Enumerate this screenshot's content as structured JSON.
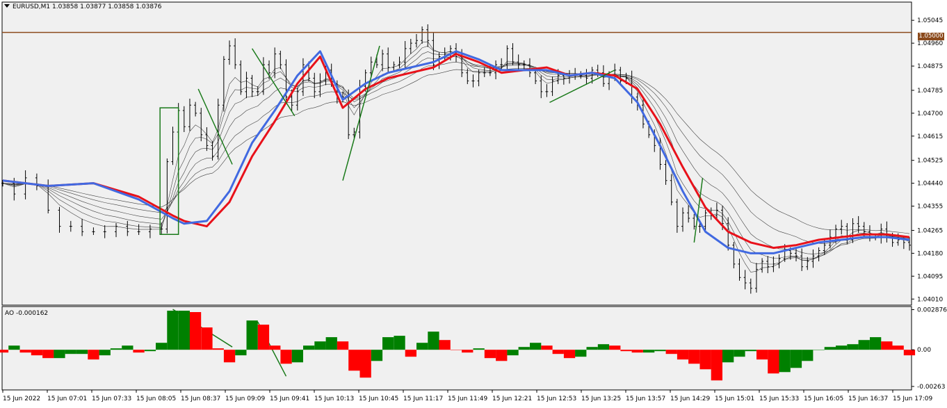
{
  "window": {
    "symbol": "EURUSD,M1",
    "ohlc": [
      "1.03858",
      "1.03877",
      "1.03858",
      "1.03876"
    ]
  },
  "price_line": {
    "label": "1.05000",
    "value": 1.05,
    "color": "#8b4a1c"
  },
  "indicator": {
    "name": "AO",
    "value": "-0.000162"
  },
  "colors": {
    "background": "#f0f0f0",
    "candles": "#000000",
    "ema_fast": "#4169e1",
    "ema_slow": "#e8111a",
    "ribbon": "#404040",
    "annotations": "#1a7a1a",
    "ao_up": "#008000",
    "ao_down": "#ff0000"
  },
  "chart_data": [
    {
      "type": "line",
      "title": "EURUSD,M1",
      "y_ticks": [
        "1.05045",
        "1.04960",
        "1.04875",
        "1.04785",
        "1.04700",
        "1.04615",
        "1.04525",
        "1.04440",
        "1.04355",
        "1.04265",
        "1.04180",
        "1.04095",
        "1.04010"
      ],
      "ylim": [
        1.0399,
        1.0511
      ],
      "x_tick_labels": [
        "15 Jun 2022",
        "15 Jun 07:01",
        "15 Jun 07:33",
        "15 Jun 08:05",
        "15 Jun 08:37",
        "15 Jun 09:09",
        "15 Jun 09:41",
        "15 Jun 10:13",
        "15 Jun 10:45",
        "15 Jun 11:17",
        "15 Jun 11:49",
        "15 Jun 12:21",
        "15 Jun 12:53",
        "15 Jun 13:25",
        "15 Jun 13:57",
        "15 Jun 14:29",
        "15 Jun 15:01",
        "15 Jun 15:33",
        "15 Jun 16:05",
        "15 Jun 16:37",
        "15 Jun 17:09"
      ],
      "series": [
        {
          "name": "",
          "color": "#e8111a",
          "x": [
            0,
            16,
            32,
            48,
            60,
            64,
            72,
            80,
            88,
            96,
            104,
            112,
            120,
            128,
            136,
            144,
            152,
            160,
            168,
            176,
            184,
            192,
            200,
            208,
            216,
            224,
            232,
            240,
            248,
            256,
            264,
            272,
            280,
            288,
            296,
            304,
            312,
            320
          ],
          "values": [
            1.0445,
            1.0443,
            1.0444,
            1.0439,
            1.0432,
            1.043,
            1.0428,
            1.0437,
            1.0454,
            1.0467,
            1.0481,
            1.0491,
            1.0472,
            1.0479,
            1.0483,
            1.0485,
            1.0487,
            1.0492,
            1.0489,
            1.0485,
            1.0486,
            1.0487,
            1.0484,
            1.0485,
            1.0484,
            1.0479,
            1.0466,
            1.045,
            1.0435,
            1.0426,
            1.0422,
            1.042,
            1.0421,
            1.0423,
            1.0424,
            1.0425,
            1.0425,
            1.0424
          ]
        },
        {
          "name": "",
          "color": "#4169e1",
          "x": [
            0,
            16,
            32,
            48,
            60,
            64,
            72,
            80,
            88,
            96,
            104,
            112,
            120,
            128,
            136,
            144,
            152,
            160,
            168,
            176,
            184,
            192,
            200,
            208,
            216,
            224,
            232,
            240,
            248,
            256,
            264,
            272,
            280,
            288,
            296,
            304,
            312,
            320
          ],
          "values": [
            1.0445,
            1.0443,
            1.0444,
            1.0438,
            1.0431,
            1.0429,
            1.043,
            1.0441,
            1.0459,
            1.0471,
            1.0484,
            1.0493,
            1.0475,
            1.0481,
            1.0485,
            1.0487,
            1.0489,
            1.0493,
            1.049,
            1.0486,
            1.0486,
            1.0486,
            1.0484,
            1.0485,
            1.0483,
            1.0474,
            1.0458,
            1.0441,
            1.0426,
            1.042,
            1.0418,
            1.0418,
            1.042,
            1.0422,
            1.0423,
            1.0424,
            1.0424,
            1.0423
          ]
        }
      ],
      "candles": {
        "x": [
          0,
          4,
          8,
          12,
          16,
          20,
          24,
          28,
          32,
          36,
          40,
          44,
          48,
          52,
          56,
          58,
          60,
          62,
          64,
          66,
          68,
          70,
          72,
          74,
          76,
          78,
          80,
          82,
          84,
          86,
          88,
          90,
          92,
          94,
          96,
          98,
          100,
          102,
          104,
          106,
          108,
          110,
          112,
          114,
          116,
          118,
          120,
          122,
          124,
          126,
          128,
          130,
          132,
          134,
          136,
          138,
          140,
          142,
          144,
          146,
          148,
          150,
          152,
          154,
          156,
          158,
          160,
          162,
          164,
          166,
          168,
          170,
          172,
          174,
          176,
          178,
          180,
          182,
          184,
          186,
          188,
          190,
          192,
          194,
          196,
          198,
          200,
          202,
          204,
          206,
          208,
          210,
          212,
          214,
          216,
          218,
          220,
          222,
          224,
          226,
          228,
          230,
          232,
          234,
          236,
          238,
          240,
          242,
          244,
          246,
          248,
          250,
          252,
          254,
          256,
          258,
          260,
          262,
          264,
          266,
          268,
          270,
          272,
          274,
          276,
          278,
          280,
          282,
          284,
          286,
          288,
          290,
          292,
          294,
          296,
          298,
          300,
          302,
          304,
          306,
          308,
          310,
          312,
          314,
          316,
          318,
          320
        ],
        "values": [
          1.0444,
          1.044,
          1.0446,
          1.0443,
          1.0434,
          1.0428,
          1.0428,
          1.0426,
          1.0426,
          1.0426,
          1.0428,
          1.0426,
          1.0426,
          1.0427,
          1.0427,
          1.0452,
          1.0463,
          1.0471,
          1.0465,
          1.0473,
          1.047,
          1.0462,
          1.0458,
          1.0454,
          1.0473,
          1.049,
          1.0495,
          1.0488,
          1.0478,
          1.0483,
          1.0478,
          1.0478,
          1.0488,
          1.0485,
          1.0492,
          1.0488,
          1.0476,
          1.0473,
          1.0478,
          1.0488,
          1.0483,
          1.0478,
          1.0482,
          1.0486,
          1.0481,
          1.0476,
          1.0476,
          1.0462,
          1.0463,
          1.048,
          1.0485,
          1.0489,
          1.0488,
          1.0492,
          1.0487,
          1.0488,
          1.0489,
          1.0494,
          1.0496,
          1.0497,
          1.0501,
          1.0497,
          1.0488,
          1.0491,
          1.0492,
          1.0494,
          1.0491,
          1.0485,
          1.0482,
          1.0482,
          1.0485,
          1.0485,
          1.0485,
          1.0488,
          1.0488,
          1.0494,
          1.0489,
          1.0488,
          1.0488,
          1.0485,
          1.0482,
          1.0478,
          1.0478,
          1.0482,
          1.0484,
          1.0483,
          1.0484,
          1.0484,
          1.0484,
          1.0483,
          1.0486,
          1.0485,
          1.0481,
          1.0484,
          1.0486,
          1.0482,
          1.0483,
          1.0476,
          1.0473,
          1.0466,
          1.0462,
          1.0458,
          1.0451,
          1.0445,
          1.0437,
          1.0428,
          1.0433,
          1.0431,
          1.0428,
          1.0428,
          1.0433,
          1.0432,
          1.0434,
          1.0429,
          1.0421,
          1.0414,
          1.0409,
          1.0407,
          1.0405,
          1.0412,
          1.0415,
          1.0413,
          1.0414,
          1.0416,
          1.0419,
          1.0418,
          1.0417,
          1.0413,
          1.0415,
          1.0417,
          1.0419,
          1.0421,
          1.0424,
          1.0427,
          1.0428,
          1.0423,
          1.0429,
          1.0428,
          1.0426,
          1.0424,
          1.0424,
          1.0427,
          1.0424,
          1.0422,
          1.0423,
          1.0422,
          1.0421
        ]
      }
    },
    {
      "type": "bar",
      "title": "AO -0.000162",
      "y_ticks": [
        "0.002876",
        "0.00",
        "-0.00263"
      ],
      "ylim": [
        -0.00283,
        0.00305
      ],
      "x": [
        0,
        4,
        8,
        12,
        16,
        20,
        24,
        28,
        32,
        36,
        40,
        44,
        48,
        52,
        56,
        60,
        64,
        68,
        72,
        76,
        80,
        84,
        88,
        92,
        96,
        100,
        104,
        108,
        112,
        116,
        120,
        124,
        128,
        132,
        136,
        140,
        144,
        148,
        152,
        156,
        160,
        164,
        168,
        172,
        176,
        180,
        184,
        188,
        192,
        196,
        200,
        204,
        208,
        212,
        216,
        220,
        224,
        228,
        232,
        236,
        240,
        244,
        248,
        252,
        256,
        260,
        264,
        268,
        272,
        276,
        280,
        284,
        288,
        292,
        296,
        300,
        304,
        308,
        312,
        316,
        320
      ],
      "values": [
        -0.0002,
        0.0003,
        -0.0002,
        -0.0004,
        -0.0006,
        -0.0006,
        -0.0003,
        -0.0003,
        -0.0007,
        -0.0004,
        0.0001,
        0.0003,
        -0.0002,
        -0.0001,
        0.0005,
        0.0028,
        0.0028,
        0.0027,
        0.0016,
        0.0001,
        -0.0009,
        -0.0004,
        0.0021,
        0.0018,
        0.0003,
        -0.001,
        -0.0009,
        0.0003,
        0.0006,
        0.0009,
        0.0006,
        -0.0015,
        -0.002,
        -0.0008,
        0.0009,
        0.001,
        -0.0005,
        0.0005,
        0.0013,
        0.0007,
        0.0,
        -0.0002,
        0.0001,
        -0.0006,
        -0.0008,
        -0.0004,
        0.0002,
        0.0005,
        0.0003,
        -0.0003,
        -0.0006,
        -0.0005,
        0.0002,
        0.0004,
        0.0003,
        -0.0001,
        -0.0002,
        -0.0002,
        -0.0001,
        -0.0003,
        -0.0007,
        -0.001,
        -0.0014,
        -0.0022,
        -0.0009,
        -0.0005,
        -0.0001,
        -0.0007,
        -0.0017,
        -0.0016,
        -0.0013,
        -0.0008,
        0.0,
        0.0002,
        0.0003,
        0.0004,
        0.0007,
        0.0009,
        0.0006,
        0.0003,
        -0.0004
      ]
    }
  ]
}
